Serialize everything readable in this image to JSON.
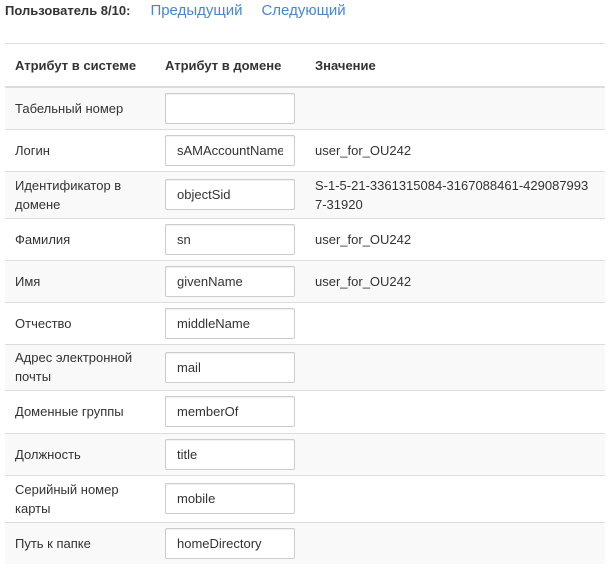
{
  "pager": {
    "label": "Пользователь 8/10:",
    "prev_label": "Предыдущий",
    "next_label": "Следующий"
  },
  "colors": {
    "link": "#4a86c8",
    "row_stripe": "#f9f9f9",
    "border": "#dddddd"
  },
  "table": {
    "headers": [
      "Атрибут в системе",
      "Атрибут в домене",
      "Значение"
    ],
    "rows": [
      {
        "system_attr": "Табельный номер",
        "domain_attr": "",
        "value": ""
      },
      {
        "system_attr": "Логин",
        "domain_attr": "sAMAccountName",
        "value": "user_for_OU242"
      },
      {
        "system_attr": "Идентификатор в домене",
        "domain_attr": "objectSid",
        "value": "S-1-5-21-3361315084-3167088461-4290879937-31920"
      },
      {
        "system_attr": "Фамилия",
        "domain_attr": "sn",
        "value": "user_for_OU242"
      },
      {
        "system_attr": "Имя",
        "domain_attr": "givenName",
        "value": "user_for_OU242"
      },
      {
        "system_attr": "Отчество",
        "domain_attr": "middleName",
        "value": ""
      },
      {
        "system_attr": "Адрес электронной почты",
        "domain_attr": "mail",
        "value": ""
      },
      {
        "system_attr": "Доменные группы",
        "domain_attr": "memberOf",
        "value": ""
      },
      {
        "system_attr": "Должность",
        "domain_attr": "title",
        "value": ""
      },
      {
        "system_attr": "Серийный номер карты",
        "domain_attr": "mobile",
        "value": ""
      },
      {
        "system_attr": "Путь к папке",
        "domain_attr": "homeDirectory",
        "value": ""
      }
    ]
  }
}
